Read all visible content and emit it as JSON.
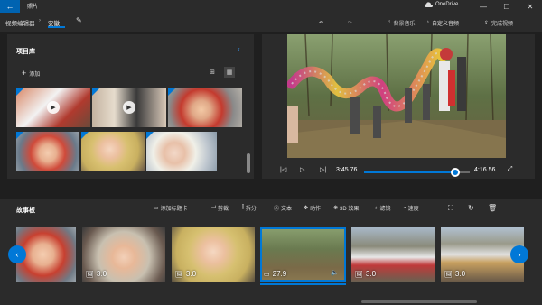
{
  "app": {
    "title": "照片",
    "onedrive": "OneDrive"
  },
  "toolbar": {
    "breadcrumb_parent": "视频编辑器",
    "breadcrumb_current": "安徽",
    "bgmusic": "背景音乐",
    "custom_audio": "自定义音频",
    "finish": "完成视频",
    "more": "···"
  },
  "library": {
    "title": "项目库",
    "add": "添加"
  },
  "preview": {
    "time_current": "3:45.76",
    "time_total": "4:16.56",
    "progress": 0.86
  },
  "storyboard": {
    "title": "故事板",
    "tools": {
      "add_title_card": "添加标题卡",
      "trim": "剪裁",
      "split": "拆分",
      "text": "文本",
      "motion": "动作",
      "effects_3d": "3D 效果",
      "filters": "滤镜",
      "speed": "速度"
    },
    "clips": [
      {
        "duration": ""
      },
      {
        "duration": "3.0"
      },
      {
        "duration": "3.0"
      },
      {
        "duration": "27.9"
      },
      {
        "duration": "3.0"
      },
      {
        "duration": "3.0"
      }
    ]
  },
  "colors": {
    "accent": "#0078d7",
    "panel": "#2b2b2b",
    "bg": "#1f1f1f"
  },
  "icons": [
    "back-icon",
    "pencil-icon",
    "undo-icon",
    "redo-icon",
    "music-icon",
    "audio-icon",
    "export-icon",
    "plus-icon",
    "grid-small-icon",
    "grid-large-icon",
    "play-icon",
    "prev-frame-icon",
    "next-frame-icon",
    "fullscreen-icon",
    "title-card-icon",
    "trim-icon",
    "split-icon",
    "text-icon",
    "motion-icon",
    "3d-icon",
    "filter-icon",
    "speed-icon",
    "resize-icon",
    "rotate-icon",
    "delete-icon",
    "chevron-left-icon",
    "chevron-right-icon",
    "photo-icon",
    "video-icon",
    "volume-icon"
  ]
}
